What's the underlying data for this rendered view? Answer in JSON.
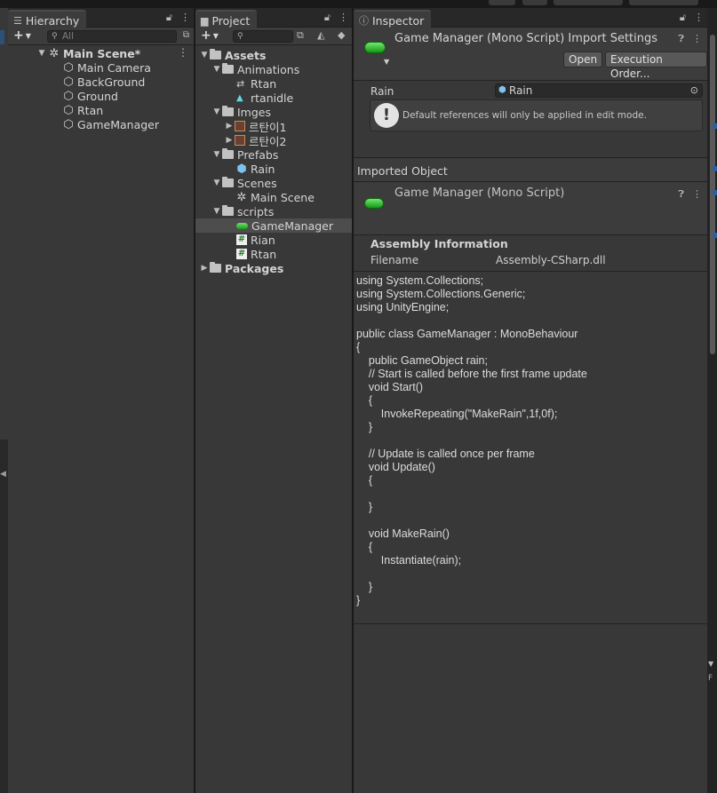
{
  "hierarchy": {
    "tab_label": "Hierarchy",
    "search_placeholder": "All",
    "scene_name": "Main Scene*",
    "items": [
      {
        "label": "Main Camera"
      },
      {
        "label": "BackGround"
      },
      {
        "label": "Ground"
      },
      {
        "label": "Rtan"
      },
      {
        "label": "GameManager"
      }
    ]
  },
  "project": {
    "tab_label": "Project",
    "tree": {
      "assets": "Assets",
      "animations": "Animations",
      "anim_items": [
        "Rtan",
        "rtanidle"
      ],
      "imges": "Imges",
      "imge_items": [
        "르탄이1",
        "르탄이2"
      ],
      "prefabs": "Prefabs",
      "prefab_items": [
        "Rain"
      ],
      "scenes": "Scenes",
      "scene_items": [
        "Main Scene"
      ],
      "scripts": "scripts",
      "script_items": [
        "GameManager",
        "Rian",
        "Rtan"
      ],
      "packages": "Packages"
    }
  },
  "inspector": {
    "tab_label": "Inspector",
    "title": "Game Manager (Mono Script) Import Settings",
    "open_label": "Open",
    "execution_order_label": "Execution Order...",
    "property_label": "Rain",
    "property_value": "Rain",
    "help_message": "Default references will only be applied in edit mode.",
    "imported_object_label": "Imported Object",
    "imported_title": "Game Manager (Mono Script)",
    "assembly_title": "Assembly Information",
    "filename_key": "Filename",
    "filename_value": "Assembly-CSharp.dll",
    "code": "using System.Collections;\nusing System.Collections.Generic;\nusing UnityEngine;\n\npublic class GameManager : MonoBehaviour\n{\n    public GameObject rain;\n    // Start is called before the first frame update\n    void Start()\n    {\n        InvokeRepeating(\"MakeRain\",1f,0f);\n    }\n\n    // Update is called once per frame\n    void Update()\n    {\n\n    }\n\n    void MakeRain()\n    {\n        Instantiate(rain);\n\n    }\n}"
  },
  "right_edge_letter": "F",
  "icons": {
    "hierarchy_tab": "list-icon",
    "project_tab": "folder-icon",
    "inspector_tab": "info-icon",
    "lock": "lock-icon",
    "menu": "kebab-icon",
    "help": "help-icon",
    "script": "mono-script-icon"
  }
}
